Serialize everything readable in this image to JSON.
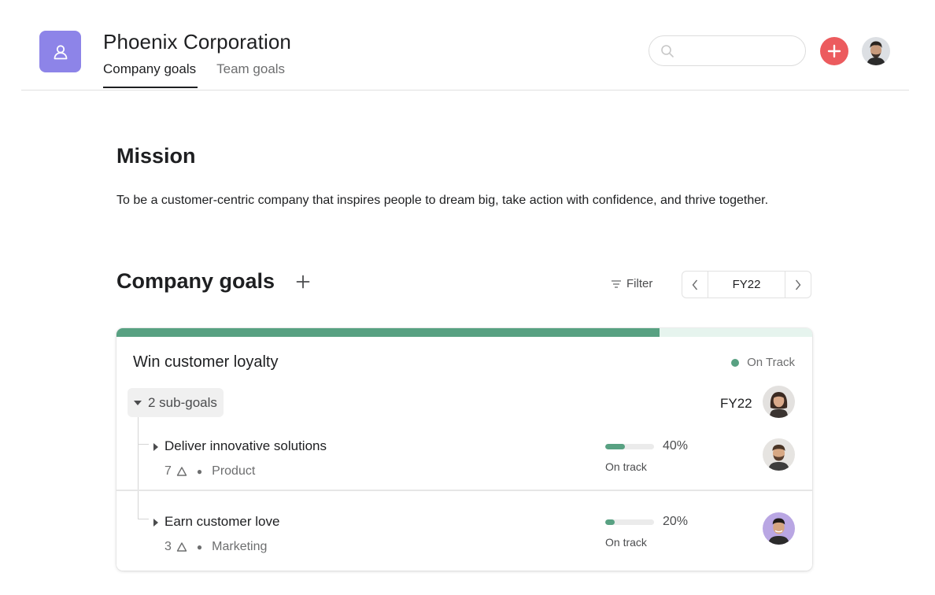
{
  "header": {
    "org_name": "Phoenix Corporation",
    "tabs": [
      {
        "label": "Company goals",
        "active": true
      },
      {
        "label": "Team goals",
        "active": false
      }
    ],
    "search_placeholder": "",
    "app_icon": "team-icon",
    "accent_color": "#8d84e8",
    "add_color": "#ec5b5e"
  },
  "mission": {
    "heading": "Mission",
    "text": "To be a customer-centric company that inspires people to dream big, take action with confidence, and thrive together."
  },
  "goals_section": {
    "heading": "Company goals",
    "filter_label": "Filter",
    "period": "FY22"
  },
  "goal": {
    "title": "Win customer loyalty",
    "status": "On Track",
    "status_color": "#58a182",
    "progress": 0.78,
    "subgoals_label": "2 sub-goals",
    "period": "FY22",
    "subgoals": [
      {
        "name": "Deliver innovative solutions",
        "count": "7",
        "team": "Product",
        "percent_label": "40%",
        "progress": 0.4,
        "status": "On track"
      },
      {
        "name": "Earn customer love",
        "count": "3",
        "team": "Marketing",
        "percent_label": "20%",
        "progress": 0.2,
        "status": "On track"
      }
    ]
  }
}
